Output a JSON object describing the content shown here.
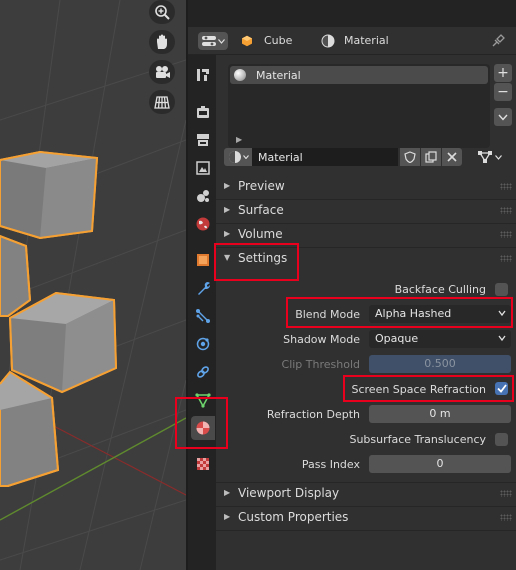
{
  "header": {
    "object_name": "Cube",
    "material_name": "Material"
  },
  "material_slots": {
    "items": [
      {
        "label": "Material"
      }
    ],
    "add_label": "+",
    "remove_label": "−"
  },
  "material_selector": {
    "name": "Material"
  },
  "panels": {
    "preview": "Preview",
    "surface": "Surface",
    "volume": "Volume",
    "settings": "Settings",
    "viewport_display": "Viewport Display",
    "custom_properties": "Custom Properties"
  },
  "settings": {
    "backface_culling": {
      "label": "Backface Culling",
      "checked": false
    },
    "blend_mode": {
      "label": "Blend Mode",
      "value": "Alpha Hashed"
    },
    "shadow_mode": {
      "label": "Shadow Mode",
      "value": "Opaque"
    },
    "clip_threshold": {
      "label": "Clip Threshold",
      "value": "0.500"
    },
    "screen_space_refraction": {
      "label": "Screen Space Refraction",
      "checked": true
    },
    "refraction_depth": {
      "label": "Refraction Depth",
      "value": "0 m"
    },
    "subsurface_translucency": {
      "label": "Subsurface Translucency",
      "checked": false
    },
    "pass_index": {
      "label": "Pass Index",
      "value": "0"
    }
  },
  "colors": {
    "highlight": "#e8001c",
    "selection_outline": "#f5a033",
    "checkbox_on": "#4772b3"
  },
  "icons": {
    "viewport_tools": [
      "zoom-icon",
      "hand-pan-icon",
      "camera-icon",
      "grid-ortho-icon"
    ],
    "property_tabs": [
      "tool-icon",
      "render-icon",
      "output-icon",
      "view-layer-icon",
      "scene-icon",
      "world-icon",
      "object-icon",
      "modifier-icon",
      "particles-icon",
      "physics-icon",
      "constraints-icon",
      "data-icon",
      "material-icon",
      "texture-icon"
    ]
  }
}
